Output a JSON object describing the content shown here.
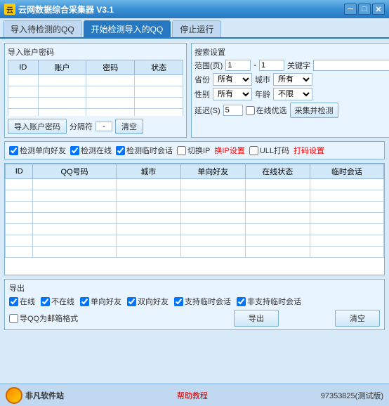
{
  "titleBar": {
    "title": "云网数据综合采集器 V3.1",
    "minBtn": "─",
    "maxBtn": "□",
    "closeBtn": "✕"
  },
  "tabs": [
    {
      "label": "导入待检测的QQ",
      "active": false
    },
    {
      "label": "开始检测导入的QQ",
      "active": true
    },
    {
      "label": "停止运行",
      "active": false
    }
  ],
  "importSection": {
    "title": "导入账户密码",
    "columns": [
      "ID",
      "账户",
      "密码",
      "状态"
    ],
    "btn_import": "导入账户密码",
    "btn_sep": "分隔符",
    "sep_value": "-",
    "btn_clear": "清空"
  },
  "searchSection": {
    "title": "搜索设置",
    "range_label": "范围(页)",
    "range_from": "1",
    "range_to": "1",
    "keyword_label": "关键字",
    "province_label": "省份",
    "province_value": "所有",
    "city_label": "城市",
    "city_value": "所有",
    "gender_label": "性别",
    "gender_value": "所有",
    "age_label": "年龄",
    "age_value": "不限",
    "delay_label": "延迟(S)",
    "delay_value": "5",
    "online_label": "在线优选",
    "collect_btn": "采集并检测"
  },
  "options": {
    "check_onesided": "检测单向好友",
    "check_online": "检测在线",
    "check_tempchat": "检测临时会话",
    "switch_ip": "切换IP",
    "ip_setting": "换IP设置",
    "ull_打": "ULL打码",
    "打码_setting": "打码设置"
  },
  "resultTable": {
    "columns": [
      "ID",
      "QQ号码",
      "城市",
      "单向好友",
      "在线状态",
      "临时会话"
    ]
  },
  "exportSection": {
    "title": "导出",
    "options": [
      {
        "label": "在线",
        "checked": true
      },
      {
        "label": "不在线",
        "checked": true
      },
      {
        "label": "单向好友",
        "checked": true
      },
      {
        "label": "双向好友",
        "checked": true
      },
      {
        "label": "支持临时会话",
        "checked": true
      },
      {
        "label": "非支持临时会话",
        "checked": true
      }
    ],
    "email_format_label": "导QQ为邮箱格式",
    "export_btn": "导出",
    "clear_btn": "清空"
  },
  "statusBar": {
    "help_link": "帮助教程",
    "version": "97353825(测试版)"
  }
}
